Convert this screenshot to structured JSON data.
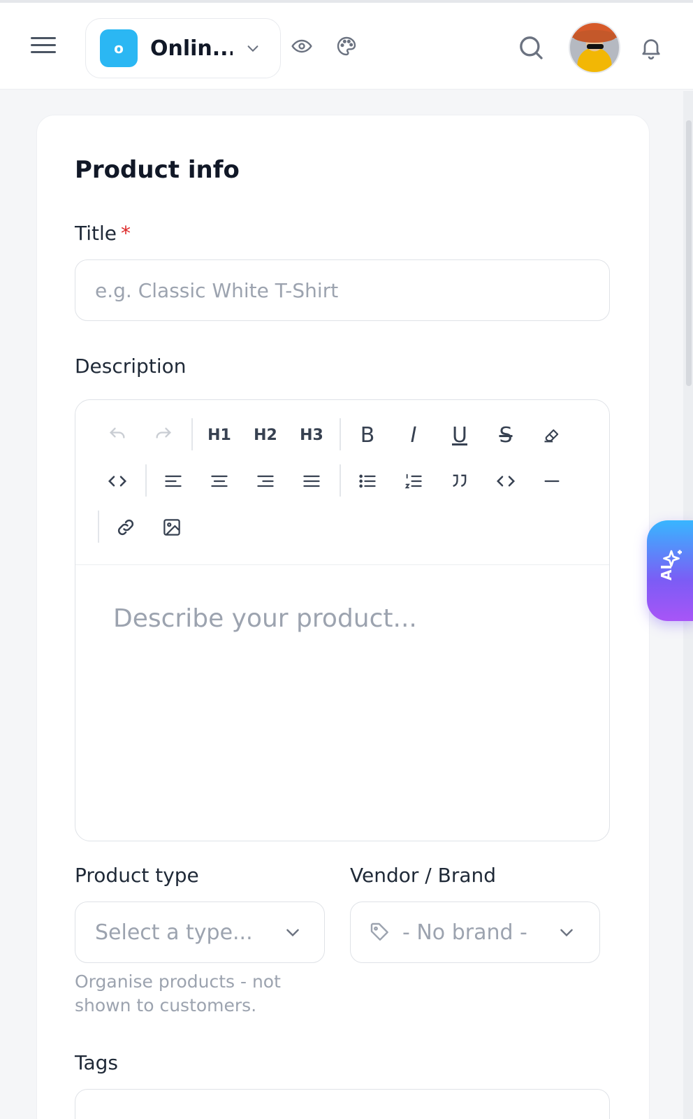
{
  "header": {
    "store_name": "Onlin...",
    "store_initial": "o"
  },
  "card": {
    "title": "Product info"
  },
  "title_field": {
    "label": "Title",
    "required_mark": "*",
    "placeholder": "e.g. Classic White T-Shirt"
  },
  "description": {
    "label": "Description",
    "placeholder": "Describe your product...",
    "toolbar": {
      "h1": "H1",
      "h2": "H2",
      "h3": "H3",
      "bold": "B",
      "italic": "I",
      "underline": "U",
      "strike": "S"
    }
  },
  "product_type": {
    "label": "Product type",
    "placeholder": "Select a type...",
    "help": "Organise products - not shown to customers."
  },
  "vendor": {
    "label": "Vendor / Brand",
    "value": "- No brand -"
  },
  "tags": {
    "label": "Tags"
  },
  "ai_button": {
    "label": "AI"
  },
  "colors": {
    "store_logo": "#2bb7f3",
    "required": "#dc2626",
    "ai_gradient_top": "#38b6ff",
    "ai_gradient_bottom": "#a855f7"
  }
}
